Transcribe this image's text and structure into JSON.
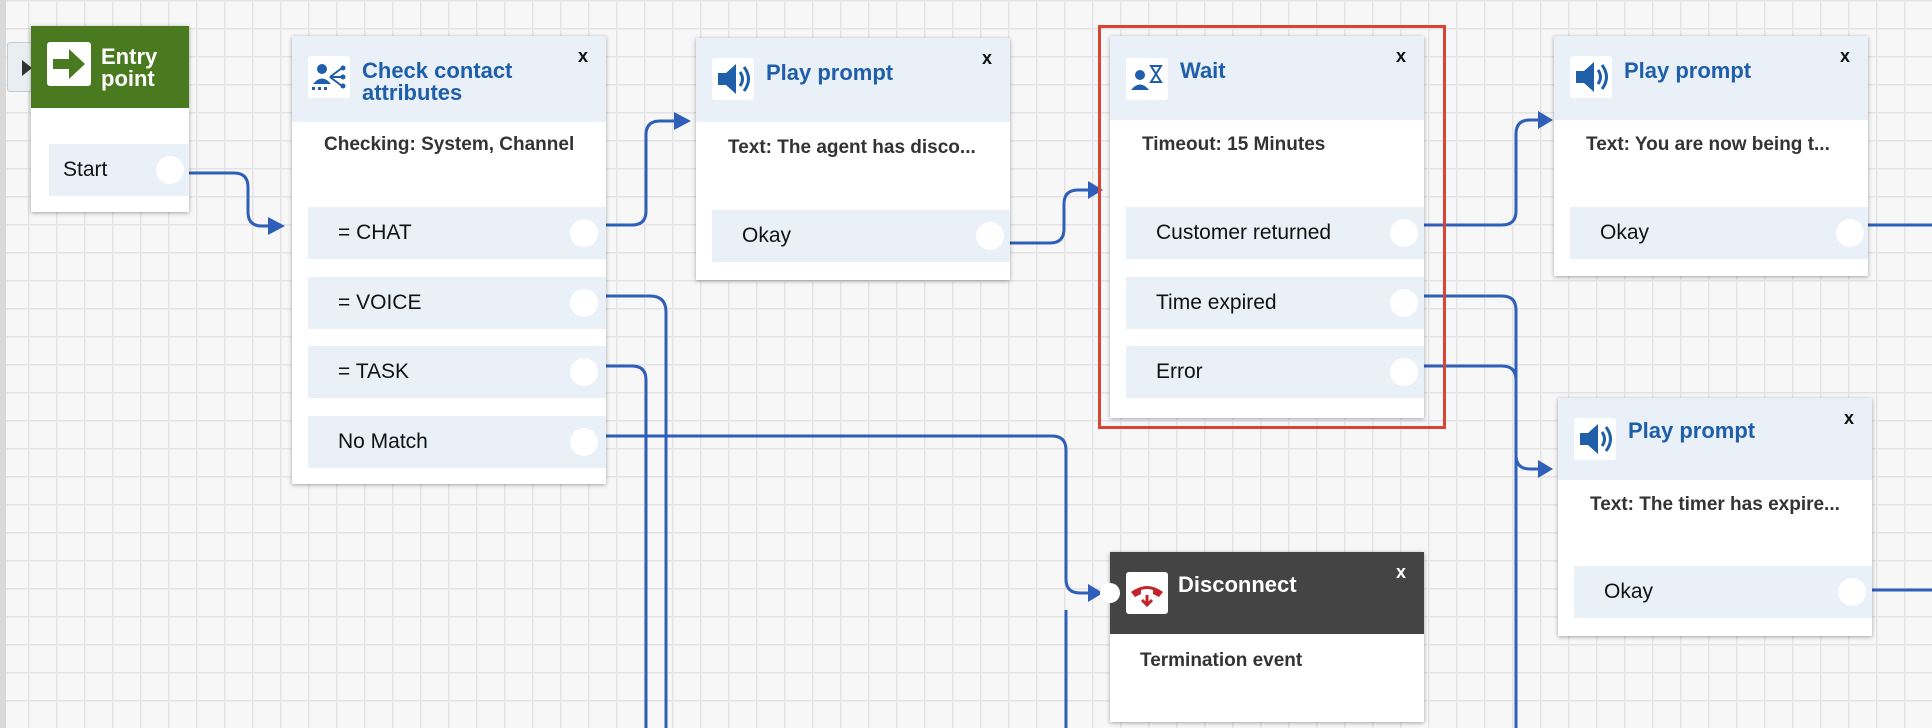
{
  "canvas": {
    "sidebar_toggle_icon": "caret-right-icon"
  },
  "entry": {
    "title": "Entry point",
    "start_label": "Start",
    "icon": "arrow-right-icon"
  },
  "check": {
    "title": "Check contact attributes",
    "desc": "Checking: System, Channel",
    "close": "x",
    "icon": "branch-icon",
    "branches": [
      "= CHAT",
      "= VOICE",
      "= TASK",
      "No Match"
    ]
  },
  "prompt1": {
    "title": "Play prompt",
    "desc": "Text: The agent has disco...",
    "close": "x",
    "branch": "Okay",
    "icon": "speaker-icon"
  },
  "wait": {
    "title": "Wait",
    "desc": "Timeout: 15 Minutes",
    "close": "x",
    "icon": "person-hourglass-icon",
    "branches": [
      "Customer returned",
      "Time expired",
      "Error"
    ],
    "highlight_color": "#d84534"
  },
  "prompt2": {
    "title": "Play prompt",
    "desc": "Text: You are now being t...",
    "close": "x",
    "branch": "Okay",
    "icon": "speaker-icon"
  },
  "prompt3": {
    "title": "Play prompt",
    "desc": "Text: The timer has expire...",
    "close": "x",
    "branch": "Okay",
    "icon": "speaker-icon"
  },
  "disconnect": {
    "title": "Disconnect",
    "desc": "Termination event",
    "close": "x",
    "icon": "hang-up-icon"
  },
  "colors": {
    "accent": "#1f5ea8",
    "wire": "#2f5fb8",
    "entry": "#4a7a1f",
    "disconnect_head": "#444444",
    "branch_bg": "#e9f0f8"
  }
}
